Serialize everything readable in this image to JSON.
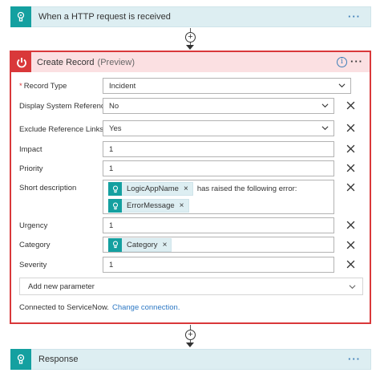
{
  "trigger": {
    "title": "When a HTTP request is received",
    "more": "···"
  },
  "action": {
    "title": "Create Record",
    "preview": "(Preview)",
    "info": "i",
    "more": "···",
    "fields": {
      "record_type": {
        "label": "Record Type",
        "required_mark": "*",
        "value": "Incident"
      },
      "display_refs": {
        "label": "Display System References",
        "value": "No"
      },
      "exclude_links": {
        "label": "Exclude Reference Links",
        "value": "Yes"
      },
      "impact": {
        "label": "Impact",
        "value": "1"
      },
      "priority": {
        "label": "Priority",
        "value": "1"
      },
      "short_description": {
        "label": "Short description",
        "token1": "LogicAppName",
        "text": "has raised the following error:",
        "token2": "ErrorMessage"
      },
      "urgency": {
        "label": "Urgency",
        "value": "1"
      },
      "category": {
        "label": "Category",
        "token": "Category"
      },
      "severity": {
        "label": "Severity",
        "value": "1"
      }
    },
    "add_parameter": "Add new parameter",
    "connected_text": "Connected to ServiceNow.",
    "change_connection": "Change connection."
  },
  "response": {
    "title": "Response",
    "more": "···"
  },
  "colors": {
    "accent_teal": "#14a0a0",
    "error_red": "#d9383a",
    "link_blue": "#2d78c4"
  },
  "icons": [
    "http-trigger-icon",
    "servicenow-power-icon",
    "info-icon",
    "chevron-down-icon",
    "close-icon",
    "token-icon",
    "add-step-plus-icon"
  ]
}
